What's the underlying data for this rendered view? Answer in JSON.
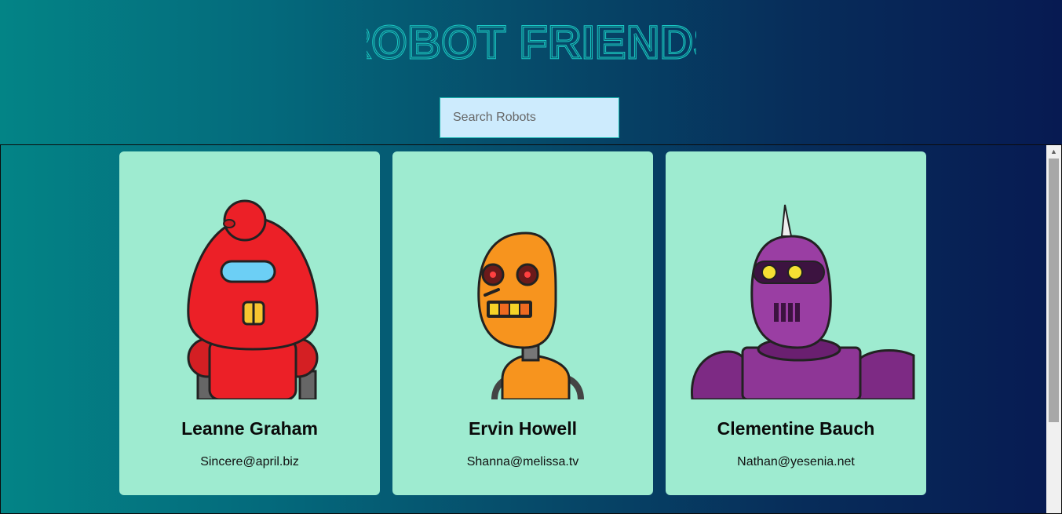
{
  "app": {
    "title": "ROBOT FRIENDS"
  },
  "search": {
    "placeholder": "Search Robots",
    "value": ""
  },
  "colors": {
    "title": "#19c7c3",
    "card_bg": "#9eebd0",
    "search_bg": "#cdebfd"
  },
  "robots": [
    {
      "name": "Leanne Graham",
      "email": "Sincere@april.biz",
      "color": "red"
    },
    {
      "name": "Ervin Howell",
      "email": "Shanna@melissa.tv",
      "color": "orange"
    },
    {
      "name": "Clementine Bauch",
      "email": "Nathan@yesenia.net",
      "color": "purple"
    }
  ]
}
